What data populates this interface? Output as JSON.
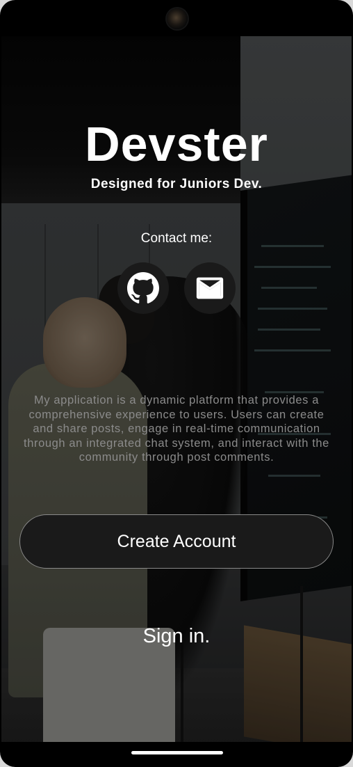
{
  "app": {
    "title": "Devster",
    "subtitle": "Designed for Juniors Dev."
  },
  "contact": {
    "label": "Contact me:",
    "icons": [
      "github-icon",
      "mail-icon"
    ]
  },
  "description": "My application is a dynamic platform that provides a comprehensive experience to users. Users can create and share posts, engage in real-time communication through an integrated chat system, and interact with the community through post comments.",
  "actions": {
    "create_account_label": "Create Account",
    "sign_in_label": "Sign in."
  },
  "colors": {
    "button_bg": "#1a1a1a",
    "button_border": "#8a8a8a",
    "text_primary": "#ffffff",
    "text_muted": "#8b8b8b"
  }
}
